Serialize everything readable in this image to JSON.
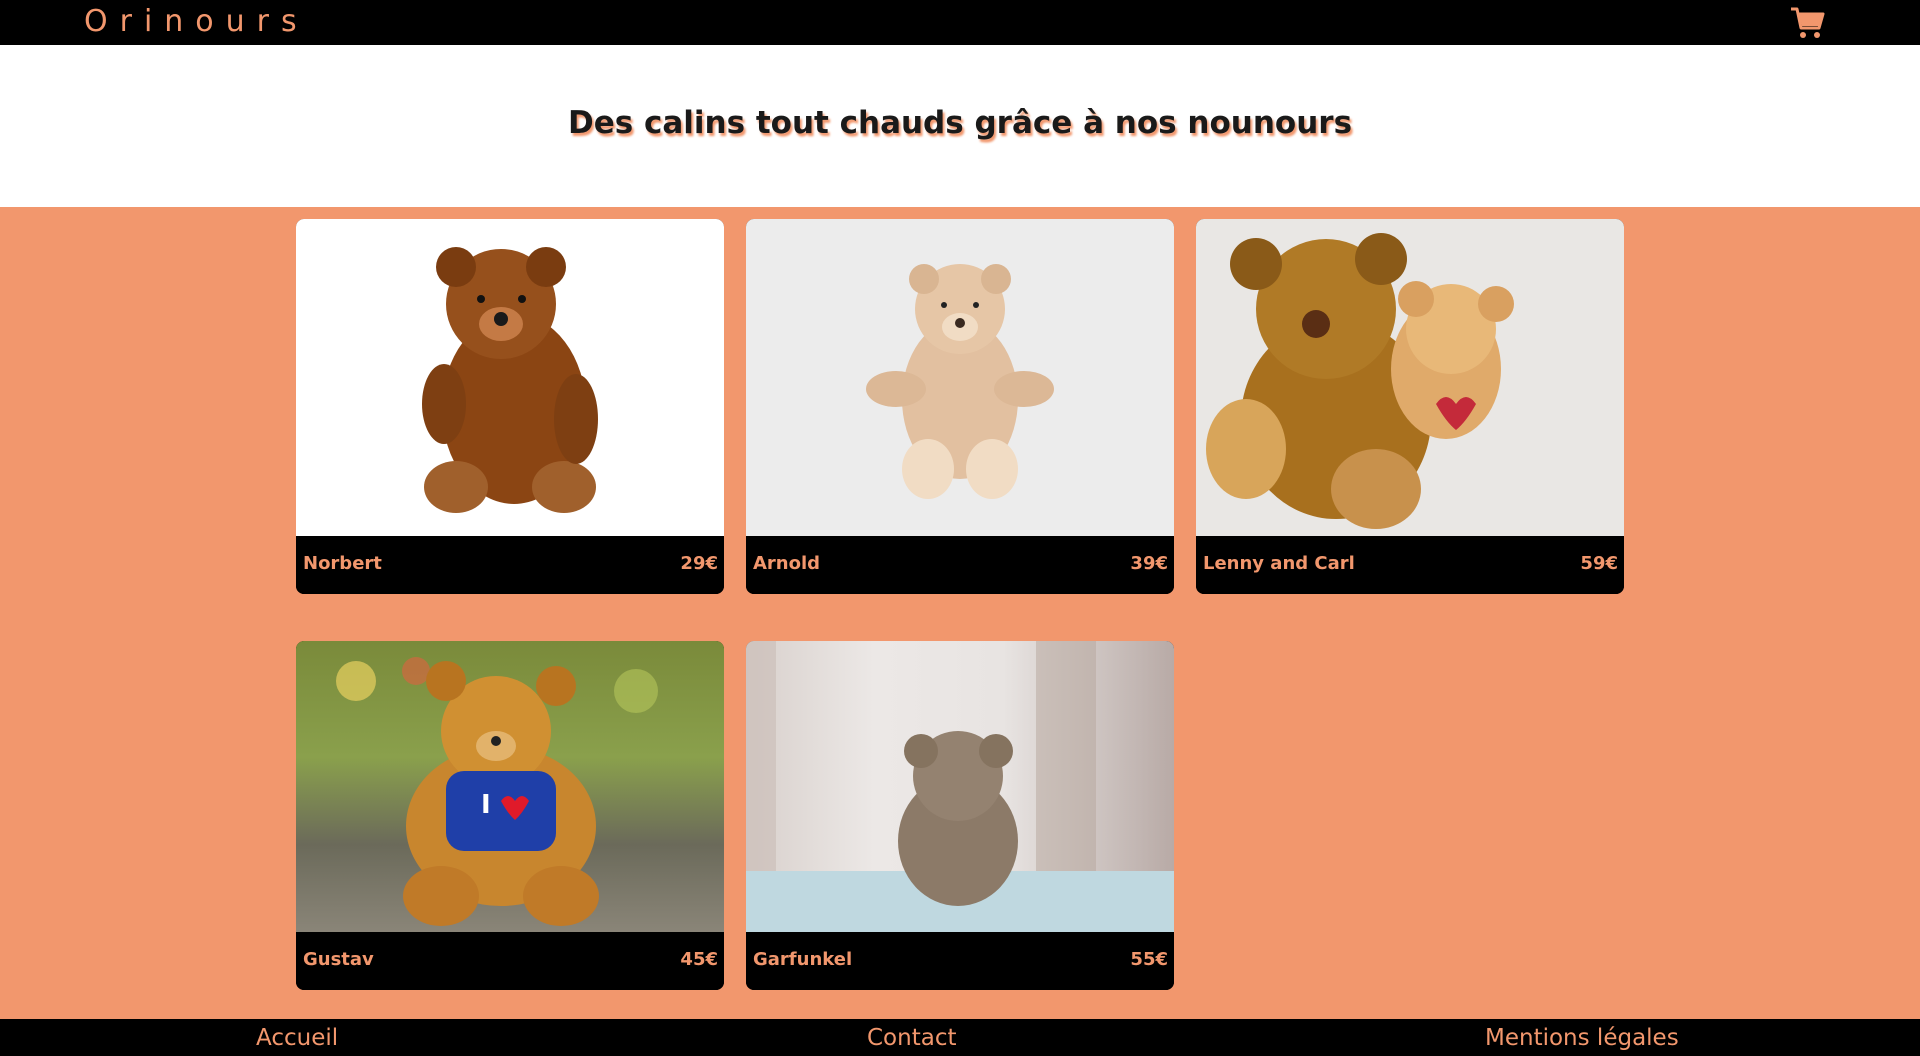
{
  "header": {
    "brand": "Orinours",
    "cart_icon": "shopping-cart-icon"
  },
  "hero": {
    "title": "Des calins tout chauds grâce à nos nounours"
  },
  "products": [
    {
      "name": "Norbert",
      "price": "29€",
      "image": "brown-teddy-bear-photo"
    },
    {
      "name": "Arnold",
      "price": "39€",
      "image": "beige-teddy-bear-photo"
    },
    {
      "name": "Lenny and Carl",
      "price": "59€",
      "image": "two-teddy-bears-hugging-photo"
    },
    {
      "name": "Gustav",
      "price": "45€",
      "image": "teddy-bear-blue-shirt-photo"
    },
    {
      "name": "Garfunkel",
      "price": "55€",
      "image": "teddy-bear-back-view-photo"
    }
  ],
  "footer": {
    "links": [
      "Accueil",
      "Contact",
      "Mentions légales"
    ]
  },
  "colors": {
    "accent": "#F2976D",
    "bar": "#000000",
    "hero_bg": "#FFFFFF"
  }
}
